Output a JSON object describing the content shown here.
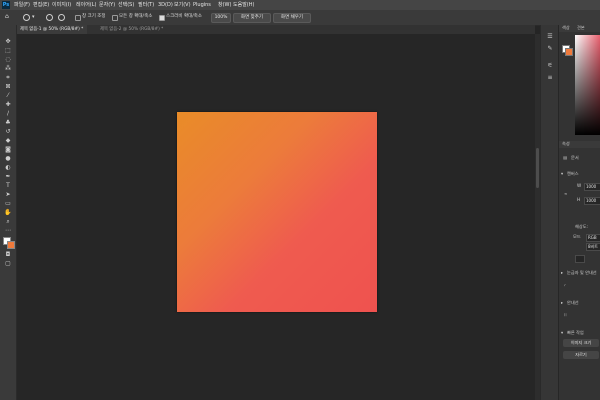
{
  "app": {
    "logo": "Ps"
  },
  "menu": [
    "파일(F)",
    "편집(E)",
    "이미지(I)",
    "레이어(L)",
    "문자(Y)",
    "선택(S)",
    "필터(T)",
    "3D(D)",
    "보기(V)",
    "Plugins",
    "창(W)",
    "도움말(H)"
  ],
  "options": {
    "resize_windows": "창 크기 조정",
    "zoom_all_windows": "모든 창 확대/축소",
    "scrubby_zoom": "스크러비 확대/축소",
    "zoom_value": "100%",
    "fit_screen": "화면 맞추기",
    "fill_screen": "화면 채우기"
  },
  "tabs": [
    "제목 없음-1 @ 50% (RGB/8#) *",
    "제목 없음-2 @ 50% (RGB/8#) *"
  ],
  "panel": {
    "swatch_tabs": [
      "색상",
      "견본"
    ],
    "properties_tab": "속성",
    "doc_label": "문서",
    "canvas_section": "캔버스",
    "w_label": "W",
    "h_label": "H",
    "width": "1000",
    "height": "1000",
    "resolution_label": "해상도:",
    "mode_label": "모드",
    "mode_value": "RGB",
    "bit_value": "8비트",
    "rulers_section": "눈금자 및 안내선",
    "guides_section": "안내선",
    "quick_actions": "빠른 작업",
    "image_size_btn": "이미지 크기",
    "crop_btn": "자르기"
  },
  "colors": {
    "gradient_start": "#e98c28",
    "gradient_end": "#ef524f"
  }
}
